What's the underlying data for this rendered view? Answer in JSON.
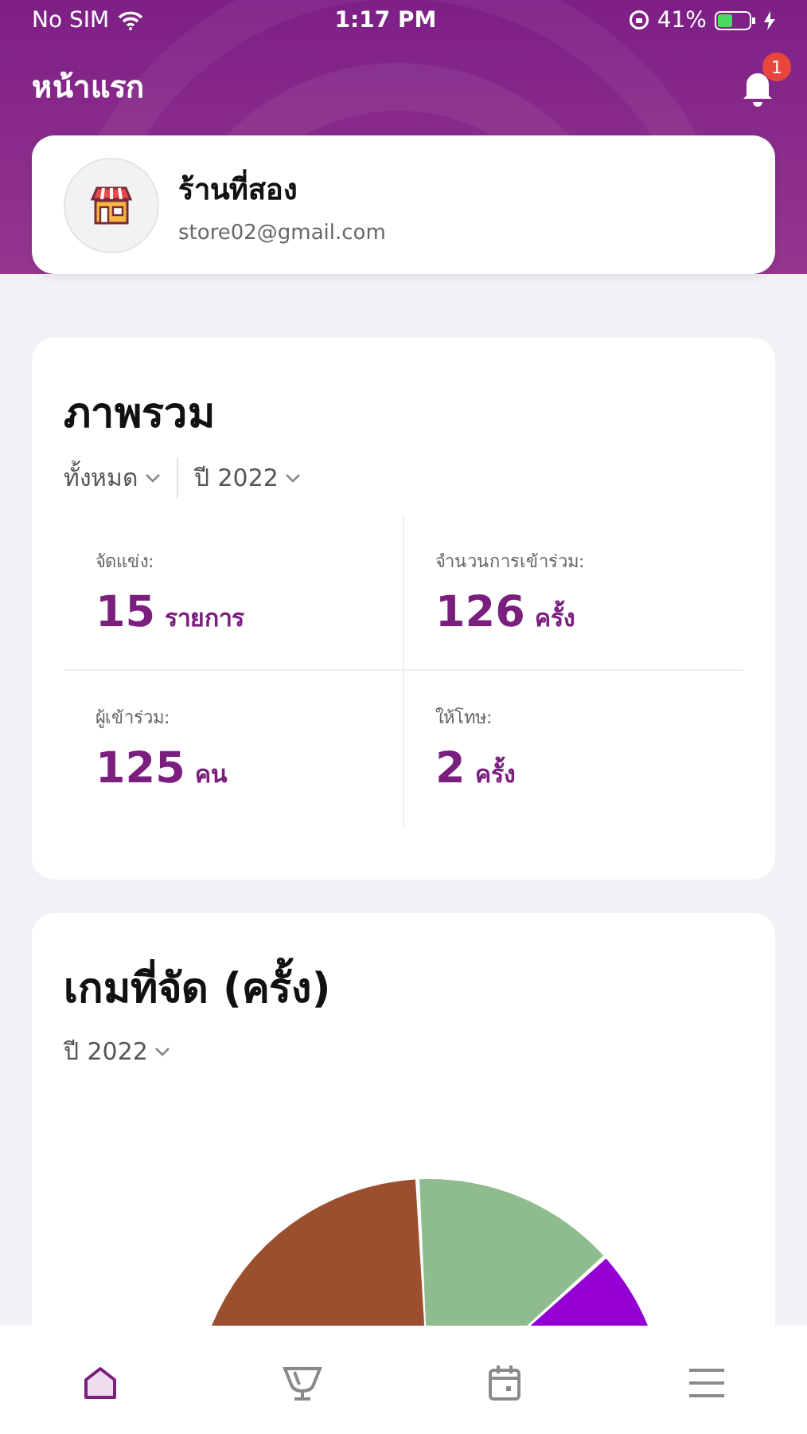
{
  "status_bar": {
    "carrier": "No SIM",
    "time": "1:17 PM",
    "battery": "41%"
  },
  "header": {
    "title": "หน้าแรก",
    "notification_count": "1"
  },
  "store": {
    "name": "ร้านที่สอง",
    "email": "store02@gmail.com"
  },
  "overview": {
    "title": "ภาพรวม",
    "filters": [
      "ทั้งหมด",
      "ปี 2022"
    ],
    "stats": [
      {
        "label": "จัดแข่ง:",
        "value": "15",
        "unit": "รายการ"
      },
      {
        "label": "จำนวนการเข้าร่วม:",
        "value": "126",
        "unit": "ครั้ง"
      },
      {
        "label": "ผู้เข้าร่วม:",
        "value": "125",
        "unit": "คน"
      },
      {
        "label": "ให้โทษ:",
        "value": "2",
        "unit": "ครั้ง"
      }
    ]
  },
  "games": {
    "title": "เกมที่จัด (ครั้ง)",
    "filter": "ปี 2022"
  },
  "tab_bar": [
    {
      "kind": "home",
      "selected": true
    },
    {
      "kind": "trophy",
      "selected": false
    },
    {
      "kind": "calendar",
      "selected": false
    },
    {
      "kind": "menu",
      "selected": false
    }
  ]
}
